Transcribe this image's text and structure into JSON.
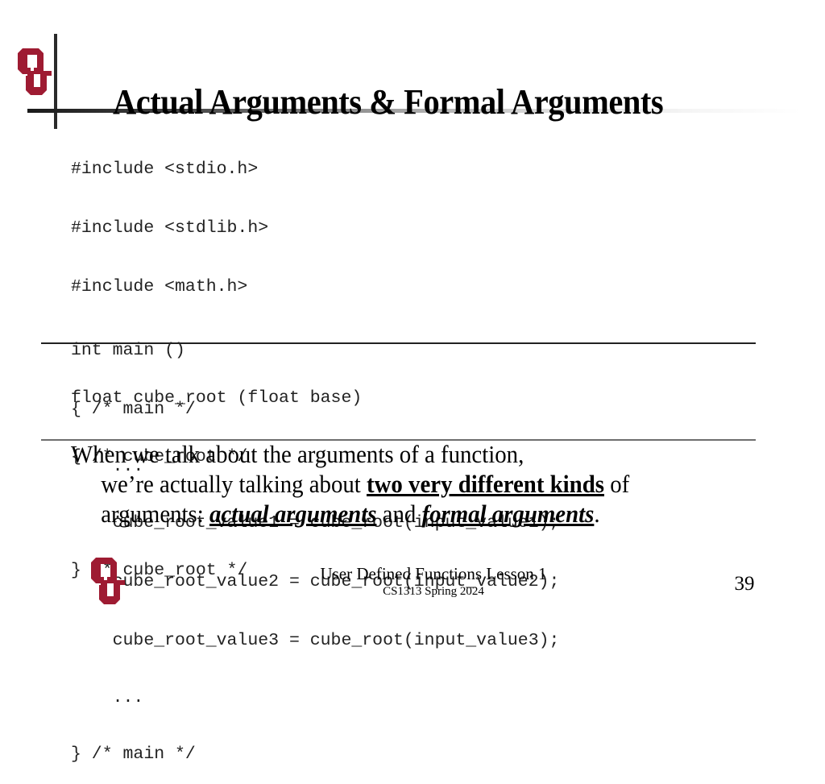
{
  "slide": {
    "title": "Actual Arguments & Formal Arguments",
    "logo": {
      "icon": "ou-logo-icon",
      "color": "#9e1b32"
    },
    "code_main": [
      "#include <stdio.h>",
      "#include <stdlib.h>",
      "#include <math.h>",
      "int main ()",
      "{ /* main */",
      "    ...",
      "    cube_root_value1 = cube_root(input_value1);",
      "    cube_root_value2 = cube_root(input_value2);",
      "    cube_root_value3 = cube_root(input_value3);",
      "    ...",
      "} /* main */"
    ],
    "code_function": [
      "float cube_root (float base)",
      "{ /* cube_root */",
      "    ...",
      "} /* cube_root */"
    ],
    "paragraph": {
      "line1": "When we talk about the arguments of a function,",
      "line2_prefix": "we’re actually talking about ",
      "line2_emphasis": "two very different kinds",
      "line2_suffix": " of",
      "line3_prefix": "arguments: ",
      "line3_emphasis1": "actual arguments",
      "line3_middle": " and ",
      "line3_emphasis2": "formal arguments",
      "line3_suffix": "."
    },
    "footer": {
      "title": "User Defined Functions Lesson 1",
      "subtitle": "CS1313 Spring 2024",
      "page_number": "39"
    }
  }
}
